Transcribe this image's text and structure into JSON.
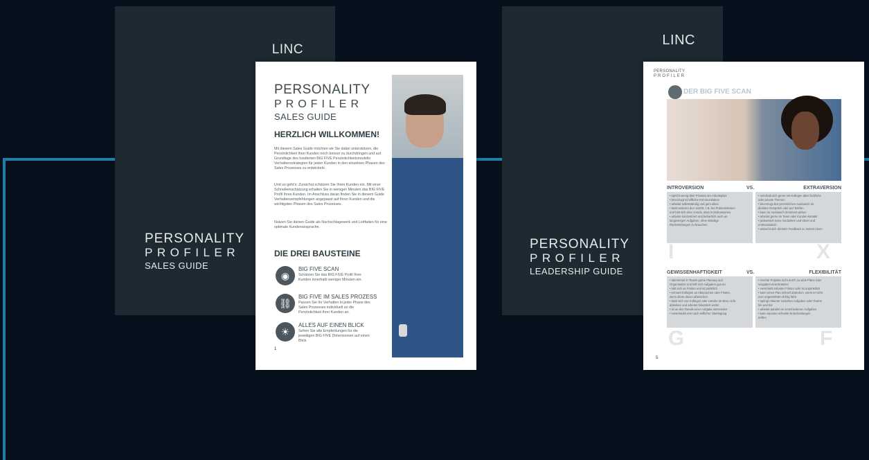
{
  "sales_cover": {
    "logo": "LINC",
    "title_line1": "PERSONALITY",
    "title_line2": "PROFILER",
    "title_line3": "SALES GUIDE"
  },
  "sales_page": {
    "title_line1": "PERSONALITY",
    "title_line2": "PROFILER",
    "title_line3": "SALES GUIDE",
    "welcome_heading": "HERZLICH WILLKOMMEN!",
    "paragraph1": "Mit diesem Sales Guide möchten wir Sie dabei unterstützen, die Persönlichkeit Ihrer Kunden noch besser zu durchdringen und auf Grundlage des fundierten BIG FIVE Persönlichkeitsmodells Verhaltensstrategien für jeden Kunden in den einzelnen Phasen des Sales Prozesses zu entwickeln.",
    "paragraph2": "Und so geht's: Zunächst schätzen Sie Ihren Kunden ein. Mit einer Schnelleinschätzung erhalten Sie in wenigen Minuten das BIG FIVE Profil Ihres Kunden. Im Anschluss daran finden Sie in diesem Guide Verhaltensempfehlungen angepasst auf Ihren Kunden und die wichtigsten Phasen des Sales Prozesses.",
    "paragraph3": "Nutzen Sie diesen Guide als Nachschlagewerk und Leitfaden für eine optimale Kundenansprache.",
    "building_blocks_heading": "DIE DREI BAUSTEINE",
    "blocks": [
      {
        "icon": "fingerprint-icon",
        "glyph": "◉",
        "title": "BIG FIVE SCAN",
        "text": "Schätzen Sie das BIG FIVE Profil Ihrer Kunden innerhalb weniger Minuten ein."
      },
      {
        "icon": "link-icon",
        "glyph": "⛓",
        "title": "BIG FIVE IM SALES PROZESS",
        "text": "Passen Sie Ihr Verhalten in jeder Phase des Sales Prozesses individuell an die Persönlichkeit Ihrer Kunden an."
      },
      {
        "icon": "lightbulb-icon",
        "glyph": "☀",
        "title": "ALLES AUF EINEN BLICK",
        "text": "Sehen Sie alle Empfehlungen für die jeweiligen BIG FIVE Dimensionen auf einen Blick."
      }
    ],
    "page_number": "1"
  },
  "leadership_cover": {
    "logo": "LINC",
    "title_line1": "PERSONALITY",
    "title_line2": "PROFILER",
    "title_line3": "LEADERSHIP GUIDE"
  },
  "leadership_page": {
    "brand_line1": "PERSONALITY",
    "brand_line2": "PROFILER",
    "section_title": "DER BIG FIVE SCAN",
    "row1": {
      "left_heading": "INTROVERSION",
      "vs": "VS.",
      "right_heading": "EXTRAVERSION",
      "left_items": [
        "• spricht wenig über Privates am Arbeitsplatz",
        "• bevorzugt schriftliche Kommunikation",
        "• arbeitet selbstständig und gern allein",
        "• lässt anderen den Vortritt, z.B. bei Präsentationen",
        "  und hält sich eher zurück, etwa in Diskussionen",
        "• arbeitet konzentriert und beharrlich auch an",
        "  langwierigen Aufgaben, ohne ständige",
        "  Rückmeldungen zu brauchen"
      ],
      "right_items": [
        "• unterhält sich gerne mit Kollegen über fachliche",
        "  oder private Themen",
        "• bevorzugt den persönlichen Austausch im",
        "  direkten Gespräch oder per Telefon",
        "• kann im Austausch dominant wirken",
        "• arbeitet gerne im Team oder Kunden-kontakt",
        "• präsentiert seine Gedanken und Ideen und",
        "  enthusiastisch",
        "• wünscht sich direktes Feedback zu seinen Ideen"
      ],
      "left_letter": "I",
      "right_letter": "X"
    },
    "row2": {
      "left_heading": "GEWISSENHAFTIGKEIT",
      "vs": "VS.",
      "right_heading": "FLEXIBILITÄT",
      "left_items": [
        "• übernimmt in Teams gerne Planung und",
        "  Organisation und teilt sich Aufgaben gut ein",
        "• hält sich an Fristen und ist pünktlich",
        "• erinnert Kollegen an Absprachen oder Fristen,",
        "  wenn diese davon abweichen",
        "• lässt sich von Kollegen oder Unruhe im Büro nicht",
        "  ablenken und arbeitet fokussiert weiter",
        "• ist an den Details einer Aufgabe interessiert",
        "• entscheidet erst nach reiflicher Überlegung"
      ],
      "right_items": [
        "• möchte Projekte nicht durch zu viele Pläne oder",
        "  Vorgaben einschränken",
        "• verschiebt mitunter Fristen oder ist unpünktlich",
        "• kann einen Plan schnell abändern, wenn er nicht",
        "  zum angestrebten Erfolg führt",
        "• springt mitunter zwischen Aufgaben oder Teams",
        "  hin und her",
        "• arbeitet parallel an verschiedenen Aufgaben",
        "• kann spontan schnelle Entscheidungen",
        "  treffen"
      ],
      "left_letter": "G",
      "right_letter": "F"
    },
    "page_number": "5"
  },
  "colors": {
    "background": "#07111d",
    "cover": "#1e2a31",
    "accent_line": "#1f7fa6"
  }
}
